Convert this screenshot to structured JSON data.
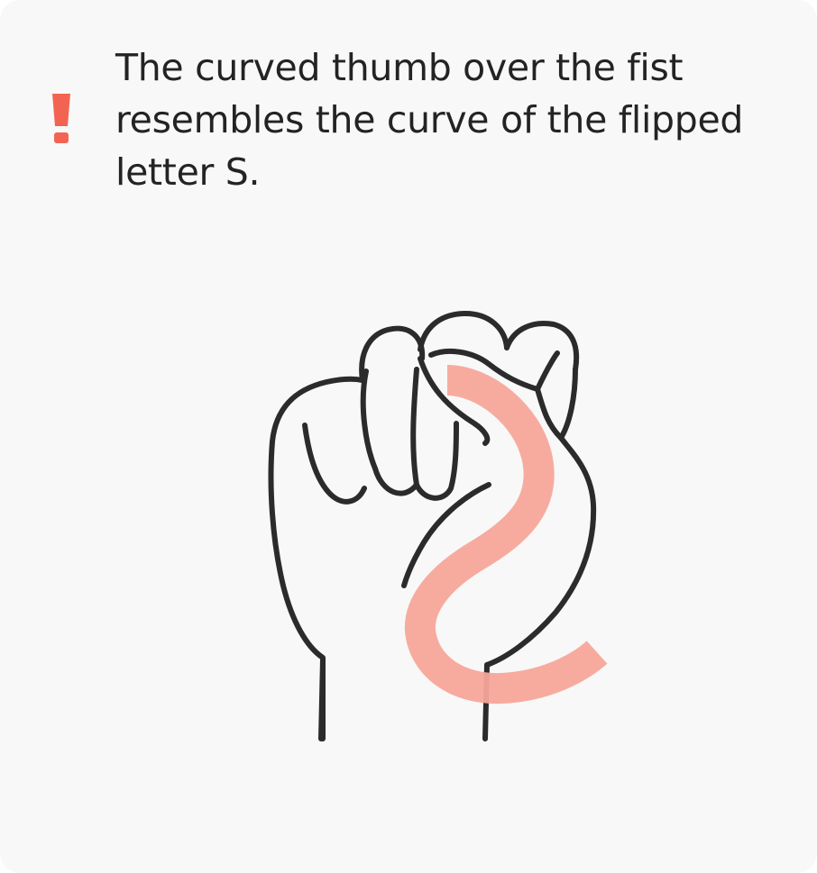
{
  "tip": {
    "icon": "exclamation-icon",
    "text": "The curved thumb over the fist resembles the curve of the flipped letter S."
  },
  "illustration": {
    "subject": "fist-hand-sign",
    "overlay": "flipped-s-curve"
  },
  "colors": {
    "card_background": "#f8f8f8",
    "text": "#232323",
    "alert_accent": "#f26451",
    "line_art": "#2b2b2b",
    "s_curve": "#f7a79a"
  }
}
